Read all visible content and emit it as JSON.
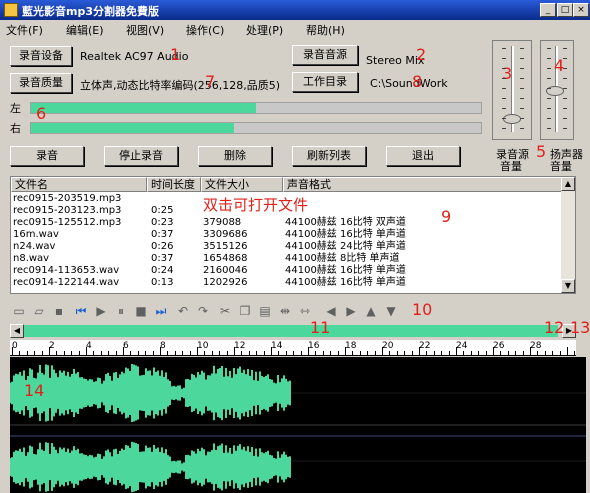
{
  "title": "藍光影音mp3分割器免費版",
  "menu": [
    "文件(F)",
    "编辑(E)",
    "视图(V)",
    "操作(C)",
    "处理(P)",
    "帮助(H)"
  ],
  "buttons": {
    "record_device": "录音设备",
    "record_quality": "录音质量",
    "record_source": "录音音源",
    "work_dir": "工作目录",
    "record": "录音",
    "stop": "停止录音",
    "delete": "删除",
    "refresh": "刷新列表",
    "exit": "退出"
  },
  "values": {
    "device": "Realtek AC97 Audio",
    "quality": "立体声,动态比特率编码(256,128,品质5)",
    "source": "Stereo Mix",
    "dir": "C:\\SoundWork"
  },
  "meters": {
    "left_label": "左",
    "right_label": "右",
    "left_level": 0.5,
    "right_level": 0.45
  },
  "sliders": {
    "source_label_1": "录音源",
    "source_label_2": "音量",
    "speaker_label_1": "扬声器",
    "speaker_label_2": "音量",
    "source_level": 0.15,
    "speaker_level": 0.5
  },
  "list": {
    "headers": [
      "文件名",
      "时间长度",
      "文件大小",
      "声音格式"
    ],
    "rows": [
      [
        "rec0915-203519.mp3",
        "",
        "",
        ""
      ],
      [
        "rec0915-203123.mp3",
        "0:25",
        "",
        ""
      ],
      [
        "rec0915-125512.mp3",
        "0:23",
        "379088",
        "44100赫兹 16比特 双声道"
      ],
      [
        "16m.wav",
        "0:37",
        "3309686",
        "44100赫兹 16比特 单声道"
      ],
      [
        "n24.wav",
        "0:26",
        "3515126",
        "44100赫兹 24比特 单声道"
      ],
      [
        "n8.wav",
        "0:37",
        "1654868",
        "44100赫兹 8比特 单声道"
      ],
      [
        "rec0914-113653.wav",
        "0:24",
        "2160046",
        "44100赫兹 16比特 单声道"
      ],
      [
        "rec0914-122144.wav",
        "0:13",
        "1202926",
        "44100赫兹 16比特 单声道"
      ]
    ],
    "overlay": "双击可打开文件"
  },
  "ruler": [
    "0",
    "2",
    "4",
    "6",
    "8",
    "10",
    "12",
    "14",
    "16",
    "18",
    "20",
    "22",
    "24",
    "26",
    "28"
  ],
  "annotations": [
    "1",
    "2",
    "3",
    "4",
    "5",
    "6",
    "7",
    "8",
    "9",
    "10",
    "11",
    "12",
    "13",
    "14"
  ],
  "colors": {
    "accent": "#4cd89c",
    "annotation": "#e0201a",
    "titlebar": "#0a2a8a"
  }
}
